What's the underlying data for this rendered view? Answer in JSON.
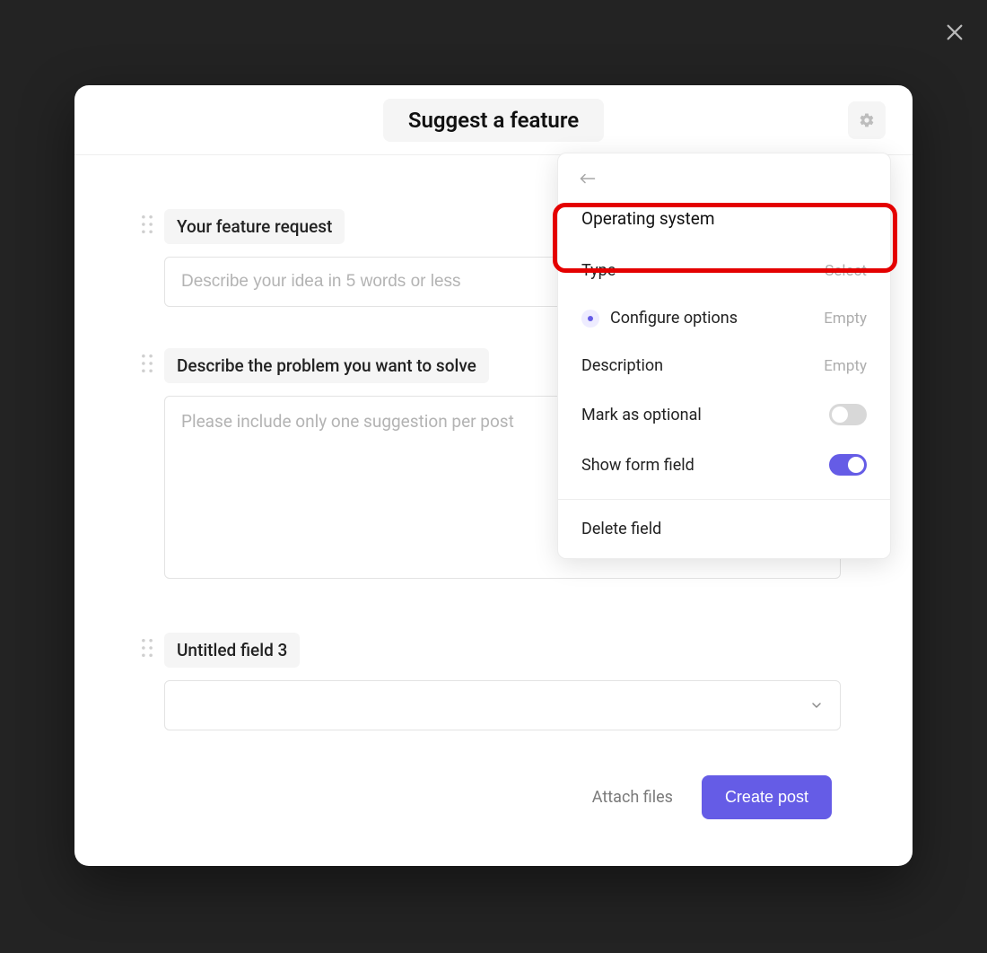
{
  "header": {
    "title": "Suggest a feature"
  },
  "fields": [
    {
      "label": "Your feature request",
      "placeholder": "Describe your idea in 5 words or less"
    },
    {
      "label": "Describe the problem you want to solve",
      "placeholder": "Please include only one suggestion per post"
    },
    {
      "label": "Untitled field 3"
    }
  ],
  "footer": {
    "attach": "Attach files",
    "create": "Create post"
  },
  "popover": {
    "name": "Operating system",
    "type_label": "Type",
    "type_value": "Select",
    "configure": "Configure options",
    "configure_state": "Empty",
    "description_label": "Description",
    "description_state": "Empty",
    "optional_label": "Mark as optional",
    "optional_value": false,
    "show_label": "Show form field",
    "show_value": true,
    "delete": "Delete field"
  }
}
